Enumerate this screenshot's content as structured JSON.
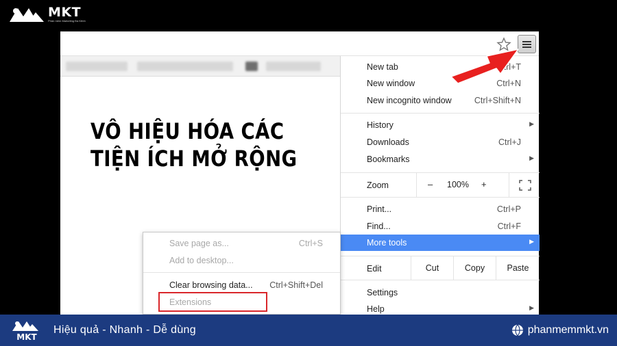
{
  "brand": {
    "name": "MKT",
    "tagline": "Phần mềm Marketing Đa Kênh"
  },
  "headline": {
    "line1": "VÔ HIỆU HÓA CÁC",
    "line2": "TIỆN ÍCH MỞ RỘNG"
  },
  "menu": {
    "items": [
      {
        "label": "New tab",
        "shortcut": "Ctrl+T"
      },
      {
        "label": "New window",
        "shortcut": "Ctrl+N"
      },
      {
        "label": "New incognito window",
        "shortcut": "Ctrl+Shift+N"
      },
      {
        "label": "History",
        "shortcut": ""
      },
      {
        "label": "Downloads",
        "shortcut": "Ctrl+J"
      },
      {
        "label": "Bookmarks",
        "shortcut": ""
      },
      {
        "label": "Print...",
        "shortcut": "Ctrl+P"
      },
      {
        "label": "Find...",
        "shortcut": "Ctrl+F"
      },
      {
        "label": "More tools",
        "shortcut": ""
      },
      {
        "label": "Settings",
        "shortcut": ""
      },
      {
        "label": "Help",
        "shortcut": ""
      }
    ],
    "zoom": {
      "label": "Zoom",
      "minus": "–",
      "value": "100%",
      "plus": "+"
    },
    "edit": {
      "label": "Edit",
      "cut": "Cut",
      "copy": "Copy",
      "paste": "Paste"
    }
  },
  "submenu": {
    "items": [
      {
        "label": "Save page as...",
        "shortcut": "Ctrl+S"
      },
      {
        "label": "Add to desktop...",
        "shortcut": ""
      },
      {
        "label": "Clear browsing data...",
        "shortcut": "Ctrl+Shift+Del"
      },
      {
        "label": "Extensions",
        "shortcut": ""
      }
    ]
  },
  "banner": {
    "slogan": "Hiệu quả - Nhanh  - Dễ dùng",
    "logo_text": "MKT",
    "website": "phanmemmkt.vn"
  },
  "colors": {
    "accent": "#4a8af4",
    "banner": "#1c3b80",
    "highlight": "#d9262a",
    "arrow": "#e8201f"
  }
}
